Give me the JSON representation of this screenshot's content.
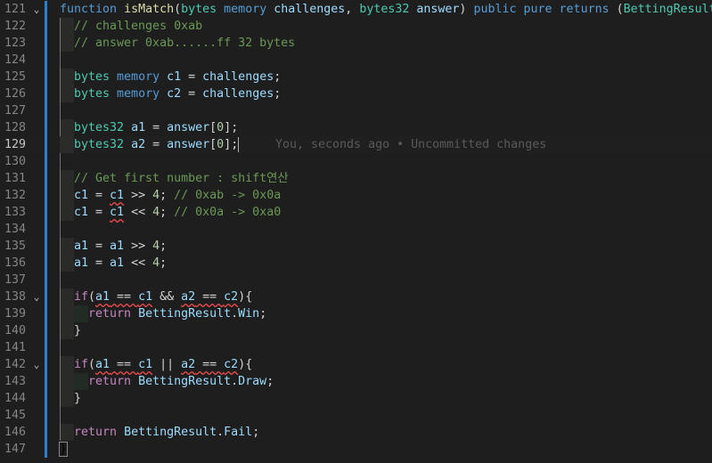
{
  "editor": {
    "blame": "You, seconds ago • Uncommitted changes",
    "lines": [
      {
        "n": "121",
        "fold": true,
        "ind": 0,
        "tokens": [
          [
            "kw",
            "function"
          ],
          [
            "tx",
            " "
          ],
          [
            "fn",
            "isMatch"
          ],
          [
            "tx",
            "("
          ],
          [
            "ty",
            "bytes"
          ],
          [
            "tx",
            " "
          ],
          [
            "kw",
            "memory"
          ],
          [
            "tx",
            " "
          ],
          [
            "vr",
            "challenges"
          ],
          [
            "tx",
            ", "
          ],
          [
            "ty",
            "bytes32"
          ],
          [
            "tx",
            " "
          ],
          [
            "vr",
            "answer"
          ],
          [
            "tx",
            ") "
          ],
          [
            "kw",
            "public"
          ],
          [
            "tx",
            " "
          ],
          [
            "kw",
            "pure"
          ],
          [
            "tx",
            " "
          ],
          [
            "kw",
            "returns"
          ],
          [
            "tx",
            " ("
          ],
          [
            "ty",
            "BettingResult"
          ],
          [
            "tx",
            ")"
          ],
          [
            "bm",
            "{"
          ]
        ]
      },
      {
        "n": "122",
        "ind": 1,
        "tokens": [
          [
            "cm",
            "// challenges 0xab"
          ]
        ]
      },
      {
        "n": "123",
        "ind": 1,
        "tokens": [
          [
            "cm",
            "// answer 0xab......ff 32 bytes"
          ]
        ]
      },
      {
        "n": "124",
        "ind": 0,
        "tokens": []
      },
      {
        "n": "125",
        "ind": 1,
        "tokens": [
          [
            "ty",
            "bytes"
          ],
          [
            "tx",
            " "
          ],
          [
            "kw",
            "memory"
          ],
          [
            "tx",
            " "
          ],
          [
            "vr",
            "c1"
          ],
          [
            "tx",
            " = "
          ],
          [
            "vr",
            "challenges"
          ],
          [
            "tx",
            ";"
          ]
        ]
      },
      {
        "n": "126",
        "ind": 1,
        "tokens": [
          [
            "ty",
            "bytes"
          ],
          [
            "tx",
            " "
          ],
          [
            "kw",
            "memory"
          ],
          [
            "tx",
            " "
          ],
          [
            "vr",
            "c2"
          ],
          [
            "tx",
            " = "
          ],
          [
            "vr",
            "challenges"
          ],
          [
            "tx",
            ";"
          ]
        ]
      },
      {
        "n": "127",
        "ind": 0,
        "tokens": []
      },
      {
        "n": "128",
        "ind": 1,
        "tokens": [
          [
            "ty",
            "bytes32"
          ],
          [
            "tx",
            " "
          ],
          [
            "vr",
            "a1"
          ],
          [
            "tx",
            " = "
          ],
          [
            "vr",
            "answer"
          ],
          [
            "tx",
            "["
          ],
          [
            "num",
            "0"
          ],
          [
            "tx",
            "];"
          ]
        ]
      },
      {
        "n": "129",
        "ind": 1,
        "current": true,
        "tokens": [
          [
            "ty",
            "bytes32"
          ],
          [
            "tx",
            " "
          ],
          [
            "vr",
            "a2"
          ],
          [
            "tx",
            " = "
          ],
          [
            "vr",
            "answer"
          ],
          [
            "tx",
            "["
          ],
          [
            "num",
            "0"
          ],
          [
            "tx",
            "];"
          ]
        ]
      },
      {
        "n": "130",
        "ind": 0,
        "tokens": []
      },
      {
        "n": "131",
        "ind": 1,
        "tokens": [
          [
            "cm",
            "// Get first number : shift연산"
          ]
        ]
      },
      {
        "n": "132",
        "ind": 1,
        "tokens": [
          [
            "vr",
            "c1"
          ],
          [
            "tx",
            " = "
          ],
          [
            "vr sq",
            "c1"
          ],
          [
            "tx",
            " >> "
          ],
          [
            "num",
            "4"
          ],
          [
            "tx",
            "; "
          ],
          [
            "cm",
            "// 0xab -> 0x0a"
          ]
        ]
      },
      {
        "n": "133",
        "ind": 1,
        "tokens": [
          [
            "vr",
            "c1"
          ],
          [
            "tx",
            " = "
          ],
          [
            "vr sq",
            "c1"
          ],
          [
            "tx",
            " << "
          ],
          [
            "num",
            "4"
          ],
          [
            "tx",
            "; "
          ],
          [
            "cm",
            "// 0x0a -> 0xa0"
          ]
        ]
      },
      {
        "n": "134",
        "ind": 0,
        "tokens": []
      },
      {
        "n": "135",
        "ind": 1,
        "tokens": [
          [
            "vr",
            "a1"
          ],
          [
            "tx",
            " = "
          ],
          [
            "vr",
            "a1"
          ],
          [
            "tx",
            " >> "
          ],
          [
            "num",
            "4"
          ],
          [
            "tx",
            ";"
          ]
        ]
      },
      {
        "n": "136",
        "ind": 1,
        "tokens": [
          [
            "vr",
            "a1"
          ],
          [
            "tx",
            " = "
          ],
          [
            "vr",
            "a1"
          ],
          [
            "tx",
            " << "
          ],
          [
            "num",
            "4"
          ],
          [
            "tx",
            ";"
          ]
        ]
      },
      {
        "n": "137",
        "ind": 0,
        "tokens": []
      },
      {
        "n": "138",
        "fold": true,
        "ind": 1,
        "tokens": [
          [
            "ctl",
            "if"
          ],
          [
            "tx",
            "("
          ],
          [
            "vr sq",
            "a1"
          ],
          [
            "tx sq",
            " == "
          ],
          [
            "vr sq",
            "c1"
          ],
          [
            "tx",
            " && "
          ],
          [
            "vr sq",
            "a2"
          ],
          [
            "tx sq",
            " == "
          ],
          [
            "vr sq",
            "c2"
          ],
          [
            "tx",
            "){"
          ]
        ]
      },
      {
        "n": "139",
        "ind": 2,
        "tokens": [
          [
            "ctl",
            "return"
          ],
          [
            "tx",
            " "
          ],
          [
            "vr",
            "BettingResult"
          ],
          [
            "tx",
            "."
          ],
          [
            "vr",
            "Win"
          ],
          [
            "tx",
            ";"
          ]
        ]
      },
      {
        "n": "140",
        "ind": 1,
        "tokens": [
          [
            "tx",
            "}"
          ]
        ]
      },
      {
        "n": "141",
        "ind": 0,
        "tokens": []
      },
      {
        "n": "142",
        "fold": true,
        "ind": 1,
        "tokens": [
          [
            "ctl",
            "if"
          ],
          [
            "tx",
            "("
          ],
          [
            "vr sq",
            "a1"
          ],
          [
            "tx sq",
            " == "
          ],
          [
            "vr sq",
            "c1"
          ],
          [
            "tx",
            " || "
          ],
          [
            "vr sq",
            "a2"
          ],
          [
            "tx sq",
            " == "
          ],
          [
            "vr sq",
            "c2"
          ],
          [
            "tx",
            "){"
          ]
        ]
      },
      {
        "n": "143",
        "ind": 2,
        "tokens": [
          [
            "ctl",
            "return"
          ],
          [
            "tx",
            " "
          ],
          [
            "vr",
            "BettingResult"
          ],
          [
            "tx",
            "."
          ],
          [
            "vr",
            "Draw"
          ],
          [
            "tx",
            ";"
          ]
        ]
      },
      {
        "n": "144",
        "ind": 1,
        "tokens": [
          [
            "tx",
            "}"
          ]
        ]
      },
      {
        "n": "145",
        "ind": 0,
        "tokens": []
      },
      {
        "n": "146",
        "ind": 1,
        "tokens": [
          [
            "ctl",
            "return"
          ],
          [
            "tx",
            " "
          ],
          [
            "vr",
            "BettingResult"
          ],
          [
            "tx",
            "."
          ],
          [
            "vr",
            "Fail"
          ],
          [
            "tx",
            ";"
          ]
        ]
      },
      {
        "n": "147",
        "ind": 0,
        "tokens": [
          [
            "bm",
            "}"
          ]
        ]
      }
    ]
  }
}
